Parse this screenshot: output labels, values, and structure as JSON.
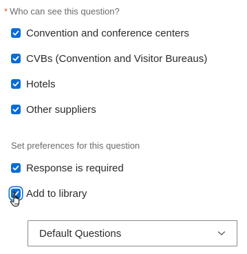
{
  "visibility": {
    "required_marker": "*",
    "title": "Who can see this question?",
    "options": [
      {
        "label": "Convention and conference centers",
        "checked": true
      },
      {
        "label": "CVBs (Convention and Visitor Bureaus)",
        "checked": true
      },
      {
        "label": "Hotels",
        "checked": true
      },
      {
        "label": "Other suppliers",
        "checked": true
      }
    ]
  },
  "preferences": {
    "title": "Set preferences for this question",
    "options": [
      {
        "label": "Response is required",
        "checked": true
      },
      {
        "label": "Add to library",
        "checked": true
      }
    ]
  },
  "library_select": {
    "value": "Default Questions",
    "icon": "chevron-down-icon"
  },
  "colors": {
    "accent": "#0a6cd6",
    "required": "#e0552b",
    "muted_text": "#6b6b6b",
    "text": "#2b2b2b"
  }
}
